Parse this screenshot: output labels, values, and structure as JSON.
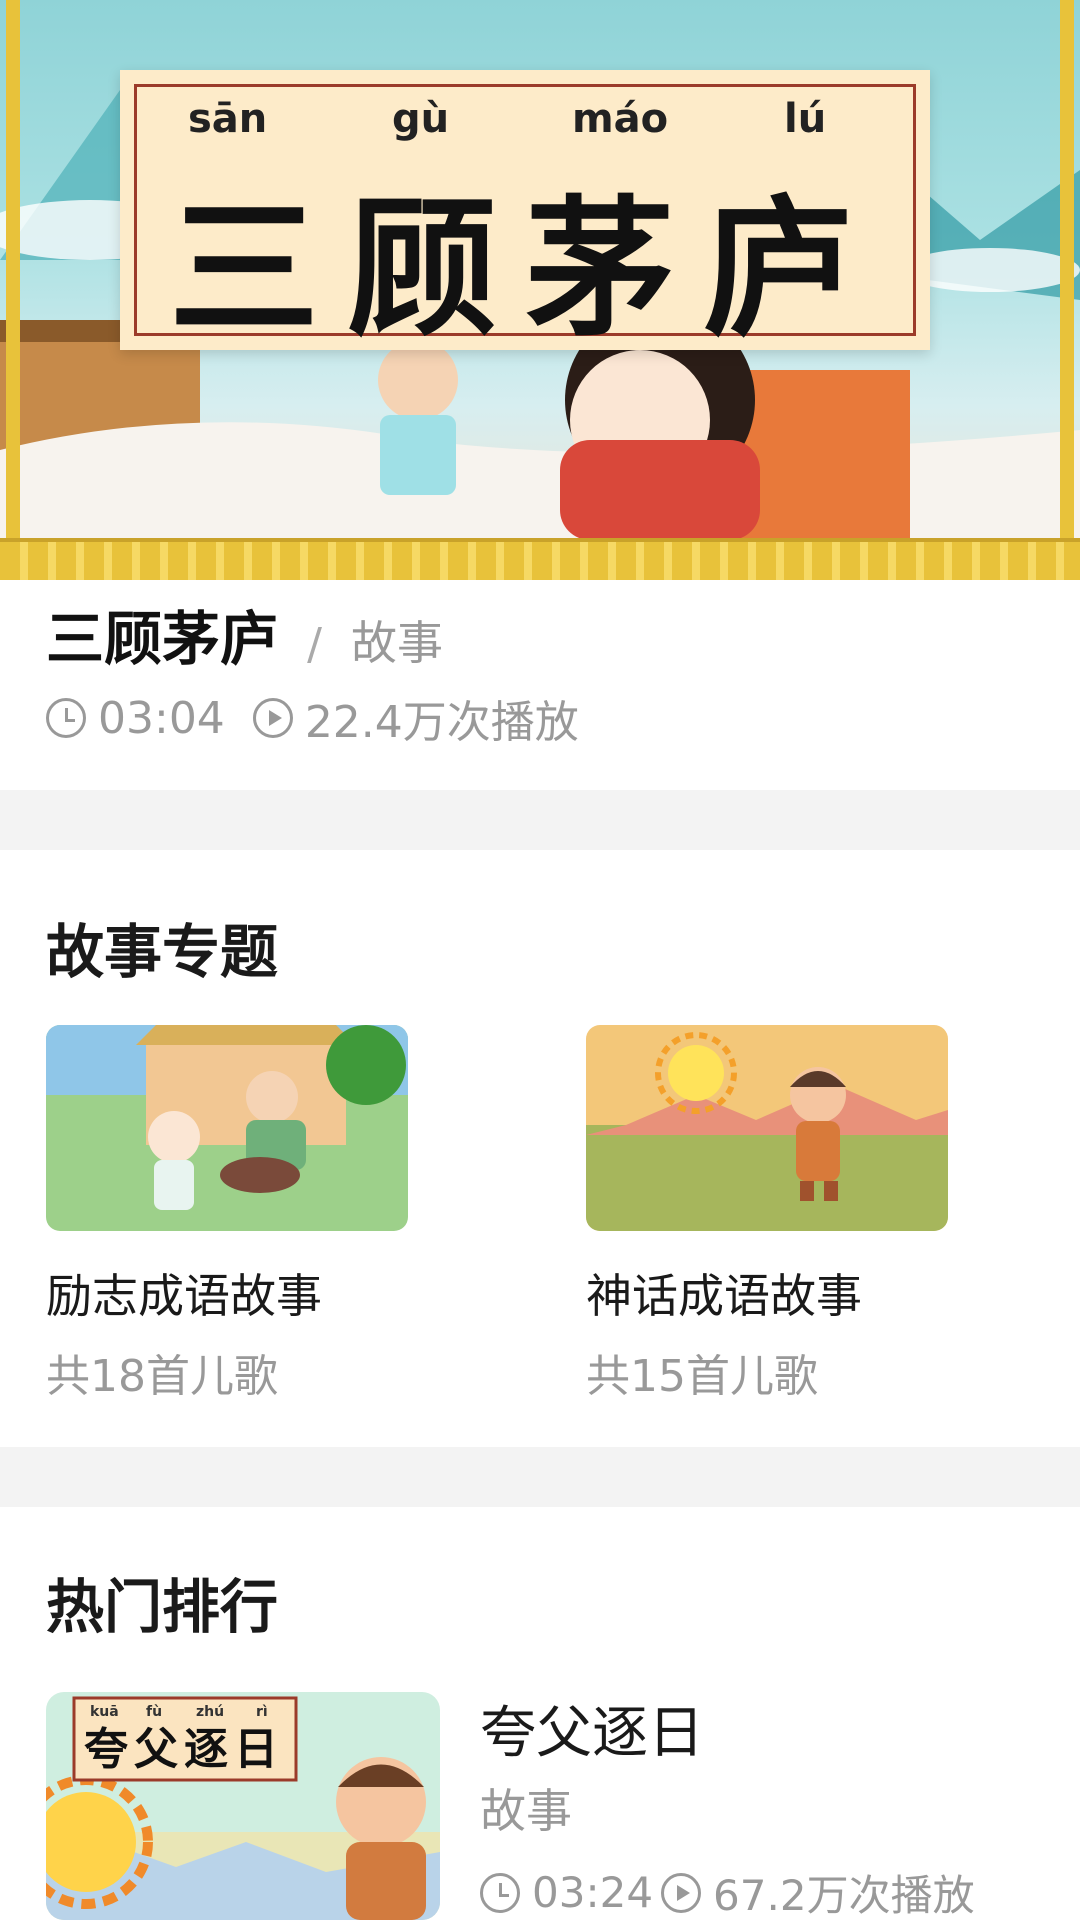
{
  "hero": {
    "pinyin": [
      "sān",
      "gù",
      "máo",
      "lú"
    ],
    "title": "三顾茅庐"
  },
  "info": {
    "title": "三顾茅庐",
    "separator": "/",
    "category": "故事",
    "duration": "03:04",
    "plays": "22.4万次播放"
  },
  "topics": {
    "heading": "故事专题",
    "items": [
      {
        "name": "励志成语故事",
        "count": "共18首儿歌"
      },
      {
        "name": "神话成语故事",
        "count": "共15首儿歌"
      }
    ]
  },
  "ranking": {
    "heading": "热门排行",
    "items": [
      {
        "title": "夸父逐日",
        "category": "故事",
        "duration": "03:24",
        "plays": "67.2万次播放",
        "thumb_pinyin": [
          "kuā",
          "fù",
          "zhú",
          "rì"
        ],
        "thumb_title": "夸父逐日"
      }
    ]
  },
  "colors": {
    "accent_gold": "#e8c23a",
    "card_cream": "#fdebc9",
    "frame_red": "#9b3b2a",
    "muted_text": "#999999",
    "divider_gray": "#f3f3f3"
  }
}
